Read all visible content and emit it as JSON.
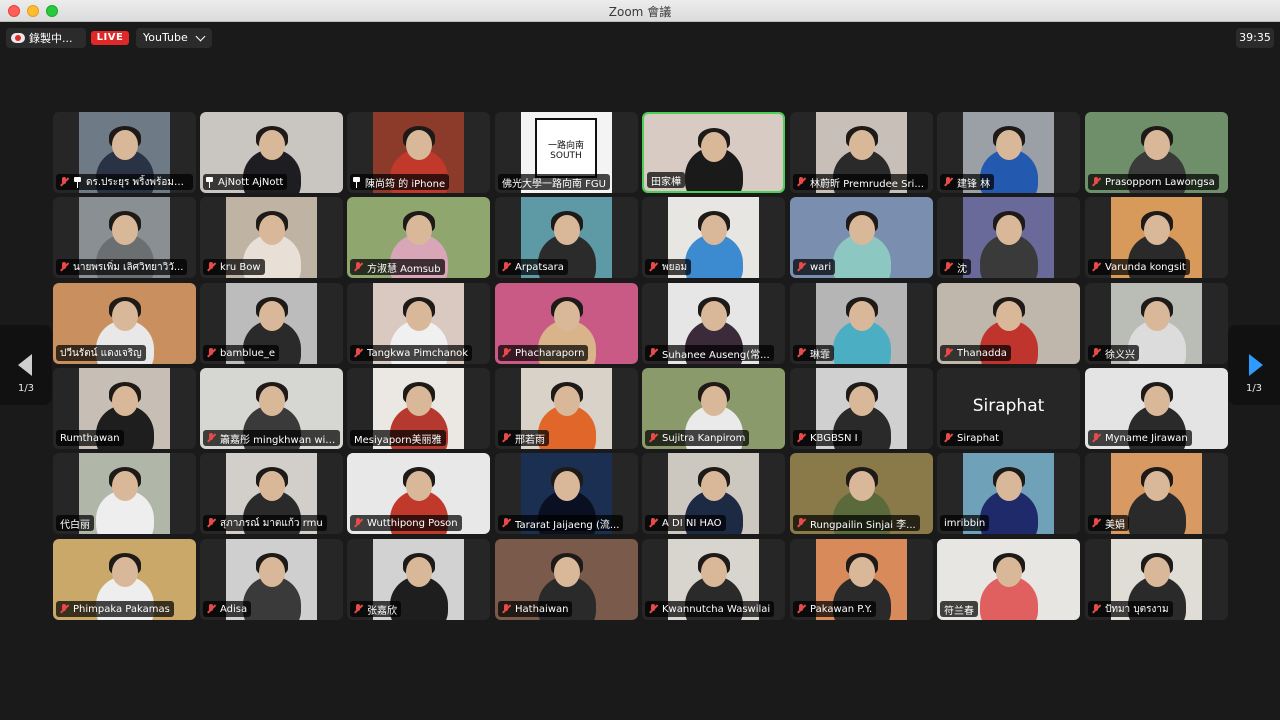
{
  "window": {
    "title": "Zoom 會議"
  },
  "topbar": {
    "recording_label": "錄製中...",
    "live_label": "LIVE",
    "stream_label": "YouTube",
    "timer": "39:35"
  },
  "pager": {
    "page_label": "1/3"
  },
  "participants": [
    {
      "name": "ดร.ประยุร พริ้งพร้อมพ...",
      "muted": true,
      "pinned": true,
      "bg": "#6e7a86",
      "shirt": "#2a3346"
    },
    {
      "name": "AjNott AjNott",
      "muted": false,
      "pinned": true,
      "bg": "#c9c5c0",
      "shirt": "#1e1e22"
    },
    {
      "name": "陳尚筠 的 iPhone",
      "muted": false,
      "pinned": true,
      "bg": "#8c3a2a",
      "shirt": "#c0392b"
    },
    {
      "name": "佛光大學一路向南 FGU",
      "muted": false,
      "pinned": false,
      "bg": "#f4f4f4",
      "shirt": "#f4f4f4",
      "logo": "一路向南 SOUTH"
    },
    {
      "name": "田家樺",
      "muted": false,
      "pinned": false,
      "bg": "#d8cbc4",
      "shirt": "#1a1a1a",
      "active": true
    },
    {
      "name": "林蔚昕 Premrudee Sri...",
      "muted": true,
      "pinned": false,
      "bg": "#c8c0b8",
      "shirt": "#2a2a2a"
    },
    {
      "name": "建锋 林",
      "muted": true,
      "pinned": false,
      "bg": "#9aa0a6",
      "shirt": "#2459b0"
    },
    {
      "name": "Prasopporn Lawongsa",
      "muted": true,
      "pinned": false,
      "bg": "#6f8f6a",
      "shirt": "#3a3a3a"
    },
    {
      "name": "นายพรเพิ่ม เลิศวิทยาวิวั...",
      "muted": true,
      "pinned": false,
      "bg": "#8a8f93",
      "shirt": "#6b6f72"
    },
    {
      "name": "kru Bow",
      "muted": true,
      "pinned": false,
      "bg": "#bfb3a4",
      "shirt": "#e8e0d6"
    },
    {
      "name": "方淑慧 Aomsub",
      "muted": true,
      "pinned": false,
      "bg": "#8fa66f",
      "shirt": "#d9a6b7"
    },
    {
      "name": "Arpatsara",
      "muted": true,
      "pinned": false,
      "bg": "#5e9aa6",
      "shirt": "#2b2b2b"
    },
    {
      "name": "พยอม",
      "muted": true,
      "pinned": false,
      "bg": "#e8e6e2",
      "shirt": "#3c8ad0"
    },
    {
      "name": "wari",
      "muted": true,
      "pinned": false,
      "bg": "#7a8fb0",
      "shirt": "#8dc7c1"
    },
    {
      "name": "沈",
      "muted": true,
      "pinned": false,
      "bg": "#6a6a9a",
      "shirt": "#3a3a3a"
    },
    {
      "name": "Varunda kongsit",
      "muted": true,
      "pinned": false,
      "bg": "#d89a5a",
      "shirt": "#2a2a2a"
    },
    {
      "name": "ปวีนรัตน์ แดงเจริญ",
      "muted": false,
      "pinned": false,
      "bg": "#c98f5f",
      "shirt": "#e8e8e8"
    },
    {
      "name": "bamblue_e",
      "muted": true,
      "pinned": false,
      "bg": "#bcbcbc",
      "shirt": "#2a2a2a"
    },
    {
      "name": "Tangkwa Pimchanok",
      "muted": true,
      "pinned": false,
      "bg": "#d9c9c0",
      "shirt": "#f0f0f0"
    },
    {
      "name": "Phacharaporn",
      "muted": true,
      "pinned": false,
      "bg": "#c95a86",
      "shirt": "#d9b38a"
    },
    {
      "name": "Suhanee Auseng(常...",
      "muted": true,
      "pinned": false,
      "bg": "#e6e6e6",
      "shirt": "#3a2a3a"
    },
    {
      "name": "琳霏",
      "muted": true,
      "pinned": false,
      "bg": "#b5b5b5",
      "shirt": "#4caec2"
    },
    {
      "name": "Thanadda",
      "muted": true,
      "pinned": false,
      "bg": "#bfb6ac",
      "shirt": "#c0342e"
    },
    {
      "name": "徐义兴",
      "muted": true,
      "pinned": false,
      "bg": "#b9bdb6",
      "shirt": "#dcdcdc"
    },
    {
      "name": "Rumthawan",
      "muted": false,
      "pinned": false,
      "bg": "#c7bfb5",
      "shirt": "#1e1e1e"
    },
    {
      "name": "簫嘉彤 mingkhwan wir...",
      "muted": true,
      "pinned": false,
      "bg": "#d6d6d2",
      "shirt": "#3a3a3a"
    },
    {
      "name": "Mesiyaporn美丽雅",
      "muted": false,
      "pinned": false,
      "bg": "#ebe7e2",
      "shirt": "#b5392e"
    },
    {
      "name": "邢若雨",
      "muted": true,
      "pinned": false,
      "bg": "#d9d2c9",
      "shirt": "#e0662a"
    },
    {
      "name": "Sujitra Kanpirom",
      "muted": true,
      "pinned": false,
      "bg": "#8a9a6a",
      "shirt": "#eaeaea"
    },
    {
      "name": "KBGBSN I",
      "muted": true,
      "pinned": false,
      "bg": "#d0d0d0",
      "shirt": "#2a2a2a"
    },
    {
      "name": "Siraphat",
      "muted": true,
      "pinned": false,
      "bg": "#262626",
      "shirt": "#262626",
      "text_only": true,
      "big": "Siraphat"
    },
    {
      "name": "Myname Jirawan",
      "muted": true,
      "pinned": false,
      "bg": "#e4e4e4",
      "shirt": "#2a2a2a"
    },
    {
      "name": "代白丽",
      "muted": false,
      "pinned": false,
      "bg": "#b0b6a8",
      "shirt": "#eeeeee"
    },
    {
      "name": "สุภาภรณ์ มาตแก้ว rmu",
      "muted": true,
      "pinned": false,
      "bg": "#d2cfca",
      "shirt": "#2a2a2a"
    },
    {
      "name": "Wutthipong Poson",
      "muted": true,
      "pinned": false,
      "bg": "#e8e8e8",
      "shirt": "#c0392b"
    },
    {
      "name": "Tararat Jaijaeng (流...",
      "muted": true,
      "pinned": false,
      "bg": "#1b2f52",
      "shirt": "#0a0f22"
    },
    {
      "name": "A DI NI HAO",
      "muted": true,
      "pinned": false,
      "bg": "#cdc8bf",
      "shirt": "#1d2a44"
    },
    {
      "name": "Rungpailin Sinjai 李...",
      "muted": true,
      "pinned": false,
      "bg": "#8a7a4a",
      "shirt": "#5a6a3a"
    },
    {
      "name": "imribbin",
      "muted": false,
      "pinned": false,
      "bg": "#6fa1b8",
      "shirt": "#1e2a6a"
    },
    {
      "name": "美娟",
      "muted": true,
      "pinned": false,
      "bg": "#d89a62",
      "shirt": "#2a2a2a"
    },
    {
      "name": "Phimpaka Pakamas",
      "muted": true,
      "pinned": false,
      "bg": "#c9a86a",
      "shirt": "#eeeeee"
    },
    {
      "name": "Adisa",
      "muted": true,
      "pinned": false,
      "bg": "#cfcfcf",
      "shirt": "#3a3a3a"
    },
    {
      "name": "张嘉欣",
      "muted": true,
      "pinned": false,
      "bg": "#d2d2d2",
      "shirt": "#1e1e1e"
    },
    {
      "name": "Hathaiwan",
      "muted": true,
      "pinned": false,
      "bg": "#7a5a4a",
      "shirt": "#2a2a2a"
    },
    {
      "name": "Kwannutcha Waswilai",
      "muted": true,
      "pinned": false,
      "bg": "#d8d4ce",
      "shirt": "#2a2a2a"
    },
    {
      "name": "Pakawan P.Y.",
      "muted": true,
      "pinned": false,
      "bg": "#d98a5a",
      "shirt": "#2a2a2a"
    },
    {
      "name": "符兰春",
      "muted": false,
      "pinned": false,
      "bg": "#e8e6e3",
      "shirt": "#e06060"
    },
    {
      "name": "ปัทมา บุตรงาม",
      "muted": true,
      "pinned": false,
      "bg": "#e0dcd6",
      "shirt": "#2a2a2a"
    }
  ]
}
